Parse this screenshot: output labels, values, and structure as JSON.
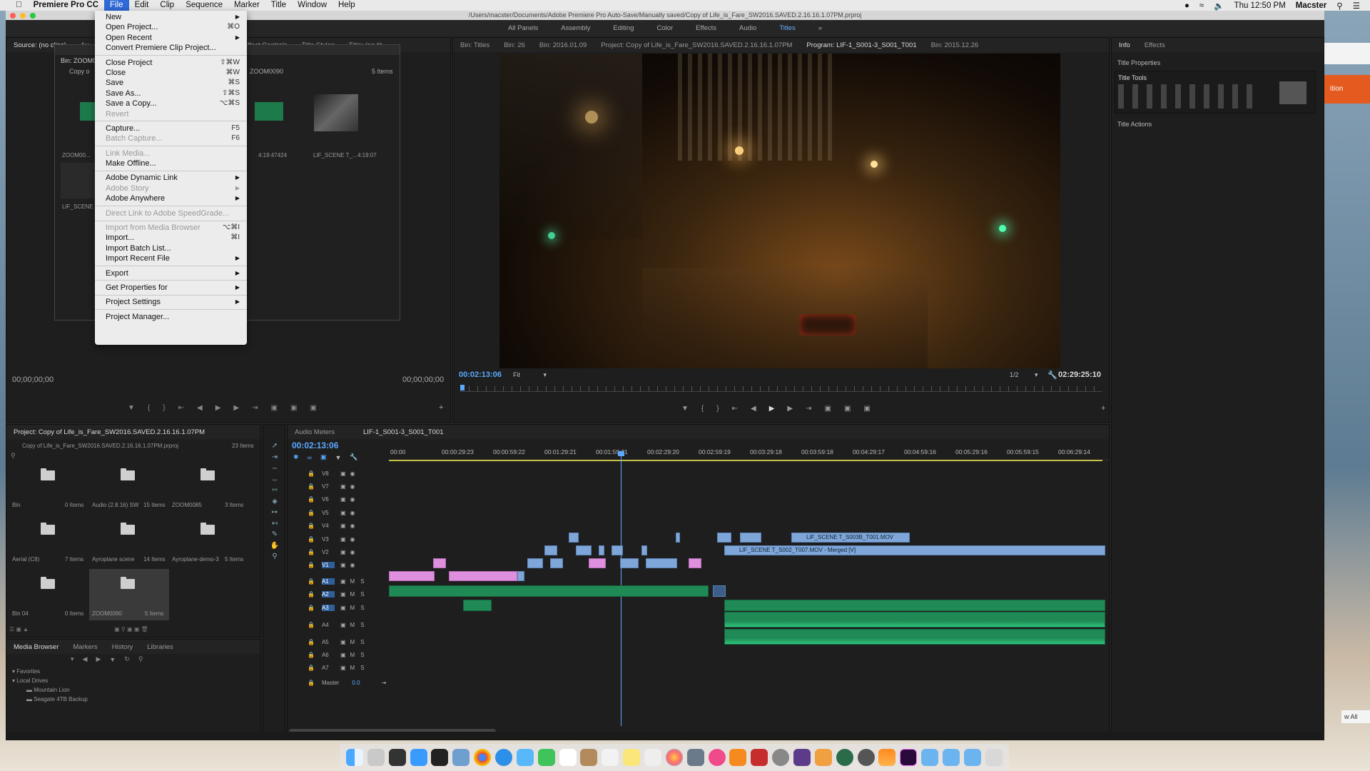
{
  "menubar": {
    "apple": "",
    "app": "Premiere Pro CC",
    "items": [
      "File",
      "Edit",
      "Clip",
      "Sequence",
      "Marker",
      "Title",
      "Window",
      "Help"
    ],
    "clock": "Thu 12:50 PM",
    "user": "Macster"
  },
  "window": {
    "title": "/Users/macster/Documents/Adobe Premiere Pro Auto-Save/Manually saved/Copy of Life_is_Fare_SW2016.SAVED.2.16.16.1.07PM.prproj",
    "workspaces": [
      "All Panels",
      "Assembly",
      "Editing",
      "Color",
      "Effects",
      "Audio",
      "Titles"
    ],
    "active_workspace": "Titles"
  },
  "source_panel": {
    "tabs": [
      "Source: (no clips)",
      "Au",
      "Effect Controls",
      "Title Styles",
      "Title: (no tit"
    ],
    "timecode_left": "00;00;00;00",
    "timecode_right": "00;00;00;00"
  },
  "bin_popup": {
    "title": "Bin: ZOOM0",
    "name": "Copy o",
    "sub": "ZOOM0090",
    "count": "5 Items",
    "items": [
      {
        "name": "ZOOM00...",
        "dur": ""
      },
      {
        "name": "0...",
        "dur": "4:19:47424"
      },
      {
        "name": "LIF_SCENE T_...",
        "dur": "4:19:07"
      },
      {
        "name": "LIF_SCENE T...",
        "dur": ""
      }
    ]
  },
  "program_panel": {
    "tabs": [
      "Bin: Titles",
      "Bin: 26",
      "Bin: 2016.01.09",
      "Project: Copy of Life_is_Fare_SW2016.SAVED.2.16.16.1.07PM",
      "Program: LIF-1_S001-3_S001_T001",
      "Bin: 2015.12.26"
    ],
    "active_tab": "Program: LIF-1_S001-3_S001_T001",
    "timecode": "00:02:13:06",
    "fit": "Fit",
    "resolution": "1/2",
    "duration": "02:29:25:10"
  },
  "right_panel": {
    "tabs": [
      "Info",
      "Effects"
    ],
    "title_properties": "Title Properties",
    "title_tools": "Title Tools",
    "title_actions": "Title Actions"
  },
  "project_panel": {
    "title": "Project: Copy of Life_is_Fare_SW2016.SAVED.2.16.16.1.07PM",
    "file": "Copy of Life_is_Fare_SW2016.SAVED.2.16.16.1.07PM.prproj",
    "count": "23 Items",
    "bins": [
      {
        "name": "Bin",
        "count": "0 Items"
      },
      {
        "name": "Audio (2.8.16) SW",
        "count": "15 Items"
      },
      {
        "name": "ZOOM0085",
        "count": "3 Items"
      },
      {
        "name": "Aerial (C8)",
        "count": "7 Items"
      },
      {
        "name": "Ayroplane scene",
        "count": "14 Items"
      },
      {
        "name": "Ayroplane-demo-3",
        "count": "5 Items"
      },
      {
        "name": "Bin 04",
        "count": "0 Items"
      },
      {
        "name": "ZOOM0090",
        "count": "5 Items"
      }
    ]
  },
  "media_browser": {
    "tabs": [
      "Media Browser",
      "Markers",
      "History",
      "Libraries"
    ],
    "favorites": "Favorites",
    "local_drives": "Local Drives",
    "drives": [
      "Mountain Lion",
      "Seagate 4TB Backup"
    ]
  },
  "timeline": {
    "tabs": [
      "Audio Meters",
      "LIF-1_S001-3_S001_T001"
    ],
    "timecode": "00:02:13:06",
    "ruler": [
      "00:00",
      "00:00:29:23",
      "00:00:59:22",
      "00:01:29:21",
      "00:01:59:21",
      "00:02:29:20",
      "00:02:59:19",
      "00:03:29:18",
      "00:03:59:18",
      "00:04:29:17",
      "00:04:59:16",
      "00:05:29:16",
      "00:05:59:15",
      "00:06:29:14"
    ],
    "video_tracks": [
      "V8",
      "V7",
      "V6",
      "V5",
      "V4",
      "V3",
      "V2",
      "V1"
    ],
    "audio_tracks": [
      "A1",
      "A2",
      "A3",
      "A4",
      "A5",
      "A6",
      "A7"
    ],
    "master": "Master",
    "master_value": "0.0",
    "clip_v4": "LIF_SCENE T_S003B_T001.MOV",
    "clip_v3": "LIF_SCENE T_S002_T007.MOV - Merged [V]"
  },
  "file_menu": {
    "items": [
      {
        "label": "New",
        "sc": "",
        "sub": true
      },
      {
        "label": "Open Project...",
        "sc": "⌘O"
      },
      {
        "label": "Open Recent",
        "sc": "",
        "sub": true
      },
      {
        "label": "Convert Premiere Clip Project...",
        "sc": ""
      },
      {
        "sep": true
      },
      {
        "label": "Close Project",
        "sc": "⇧⌘W"
      },
      {
        "label": "Close",
        "sc": "⌘W"
      },
      {
        "label": "Save",
        "sc": "⌘S"
      },
      {
        "label": "Save As...",
        "sc": "⇧⌘S"
      },
      {
        "label": "Save a Copy...",
        "sc": "⌥⌘S"
      },
      {
        "label": "Revert",
        "sc": "",
        "dis": true
      },
      {
        "sep": true
      },
      {
        "label": "Capture...",
        "sc": "F5"
      },
      {
        "label": "Batch Capture...",
        "sc": "F6",
        "dis": true
      },
      {
        "sep": true
      },
      {
        "label": "Link Media...",
        "sc": "",
        "dis": true
      },
      {
        "label": "Make Offline...",
        "sc": ""
      },
      {
        "sep": true
      },
      {
        "label": "Adobe Dynamic Link",
        "sc": "",
        "sub": true
      },
      {
        "label": "Adobe Story",
        "sc": "",
        "sub": true,
        "dis": true
      },
      {
        "label": "Adobe Anywhere",
        "sc": "",
        "sub": true
      },
      {
        "sep": true
      },
      {
        "label": "Direct Link to Adobe SpeedGrade...",
        "sc": "",
        "dis": true
      },
      {
        "sep": true
      },
      {
        "label": "Import from Media Browser",
        "sc": "⌥⌘I",
        "dis": true
      },
      {
        "label": "Import...",
        "sc": "⌘I"
      },
      {
        "label": "Import Batch List...",
        "sc": ""
      },
      {
        "label": "Import Recent File",
        "sc": "",
        "sub": true
      },
      {
        "sep": true
      },
      {
        "label": "Export",
        "sc": "",
        "sub": true
      },
      {
        "sep": true
      },
      {
        "label": "Get Properties for",
        "sc": "",
        "sub": true
      },
      {
        "sep": true
      },
      {
        "label": "Project Settings",
        "sc": "",
        "sub": true
      },
      {
        "sep": true
      },
      {
        "label": "Project Manager...",
        "sc": ""
      }
    ]
  },
  "desktop_side": {
    "badge": "ition",
    "button": "w All"
  },
  "colors": {
    "accent_blue": "#2f6ad8",
    "timecode_blue": "#5aa9ff",
    "video_clip": "#7ea6d8",
    "pink_clip": "#de8fde",
    "audio_clip": "#1f8a55"
  }
}
